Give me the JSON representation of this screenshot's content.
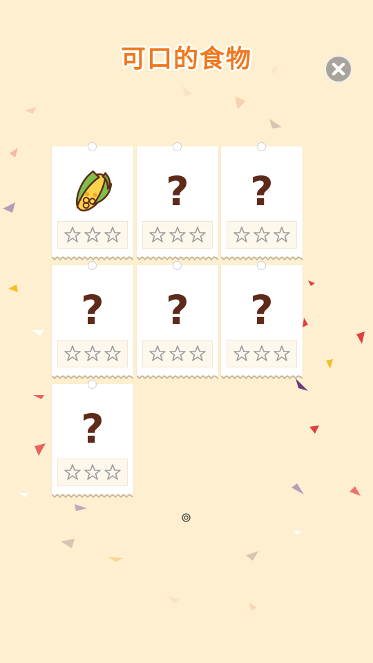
{
  "header": {
    "title": "可口的食物"
  },
  "close_button": {
    "icon": "close-icon"
  },
  "cards": [
    {
      "unlocked": true,
      "icon": "corn-icon",
      "label": "",
      "stars": 0
    },
    {
      "unlocked": false,
      "label": "?",
      "stars": 0
    },
    {
      "unlocked": false,
      "label": "?",
      "stars": 0
    },
    {
      "unlocked": false,
      "label": "?",
      "stars": 0
    },
    {
      "unlocked": false,
      "label": "?",
      "stars": 0
    },
    {
      "unlocked": false,
      "label": "?",
      "stars": 0
    },
    {
      "unlocked": false,
      "label": "?",
      "stars": 0
    }
  ],
  "max_stars": 3,
  "colors": {
    "background": "#fdefcf",
    "title": "#f0781e",
    "question_mark": "#5e2a1a"
  }
}
